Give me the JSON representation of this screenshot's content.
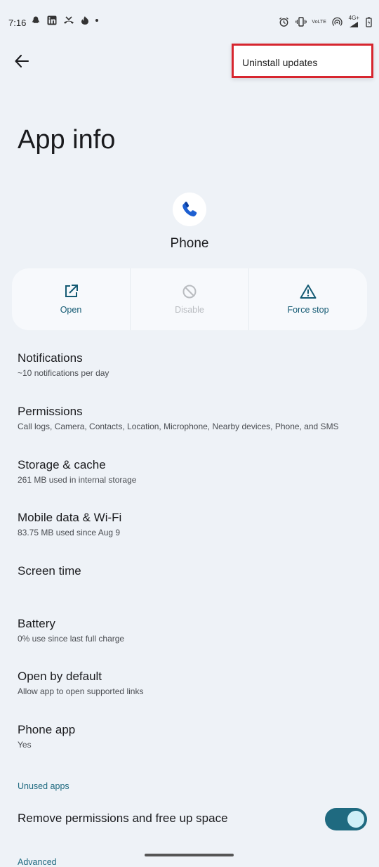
{
  "status_bar": {
    "time": "7:16",
    "lte_label": "VoLTE",
    "network_label": "4G+"
  },
  "menu": {
    "uninstall_updates": "Uninstall updates"
  },
  "header": {
    "title": "App info"
  },
  "app": {
    "name": "Phone"
  },
  "actions": [
    {
      "label": "Open",
      "icon": "open-external-icon",
      "enabled": true
    },
    {
      "label": "Disable",
      "icon": "disable-icon",
      "enabled": false
    },
    {
      "label": "Force stop",
      "icon": "warning-icon",
      "enabled": true
    }
  ],
  "settings": [
    {
      "title": "Notifications",
      "subtitle": "~10 notifications per day"
    },
    {
      "title": "Permissions",
      "subtitle": "Call logs, Camera, Contacts, Location, Microphone, Nearby devices, Phone, and SMS"
    },
    {
      "title": "Storage & cache",
      "subtitle": "261 MB used in internal storage"
    },
    {
      "title": "Mobile data & Wi-Fi",
      "subtitle": "83.75 MB used since Aug 9"
    },
    {
      "title": "Screen time",
      "subtitle": ""
    },
    {
      "title": "Battery",
      "subtitle": "0% use since last full charge"
    },
    {
      "title": "Open by default",
      "subtitle": "Allow app to open supported links"
    },
    {
      "title": "Phone app",
      "subtitle": "Yes"
    }
  ],
  "unused_apps": {
    "header": "Unused apps",
    "remove_permissions_label": "Remove permissions and free up space",
    "toggle_on": true
  },
  "advanced": {
    "header": "Advanced"
  },
  "colors": {
    "accent": "#1f6a80",
    "highlight_border": "#d7262f",
    "background": "#eef2f7"
  }
}
